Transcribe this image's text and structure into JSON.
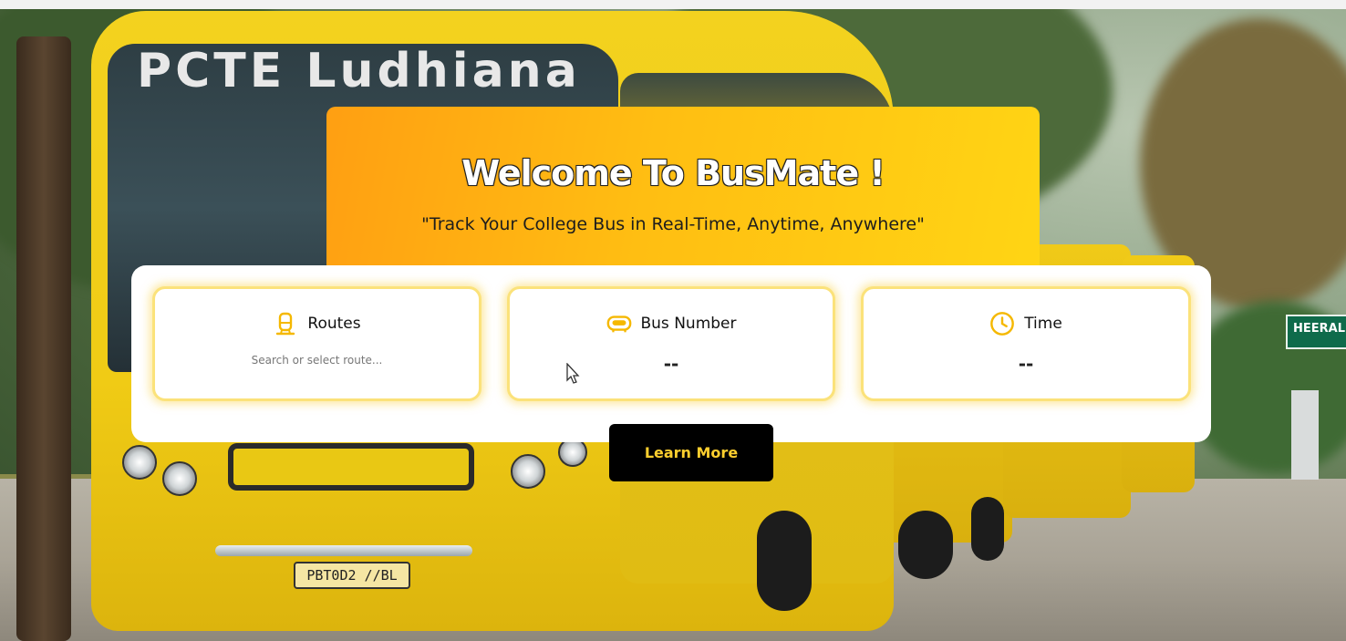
{
  "hero": {
    "title": "Welcome To BusMate !",
    "subtitle": "\"Track Your College Bus in Real-Time, Anytime, Anywhere\""
  },
  "background": {
    "bus_sign": "PCTE  Ludhiana",
    "plate": "PBT0D2 //BL",
    "signboard": "HEERAL"
  },
  "cards": {
    "routes": {
      "label": "Routes",
      "placeholder": "Search or select route...",
      "icon": "bus-icon"
    },
    "bus_number": {
      "label": "Bus Number",
      "value": "--",
      "icon": "bus-front-icon"
    },
    "time": {
      "label": "Time",
      "value": "--",
      "icon": "clock-icon"
    }
  },
  "actions": {
    "learn_more": "Learn More"
  },
  "colors": {
    "accent_gold": "#FFC21A",
    "hero_orange": "#FF9F12",
    "card_border": "#FBE27A",
    "button_bg": "#000000",
    "button_text": "#FFCF2E"
  }
}
